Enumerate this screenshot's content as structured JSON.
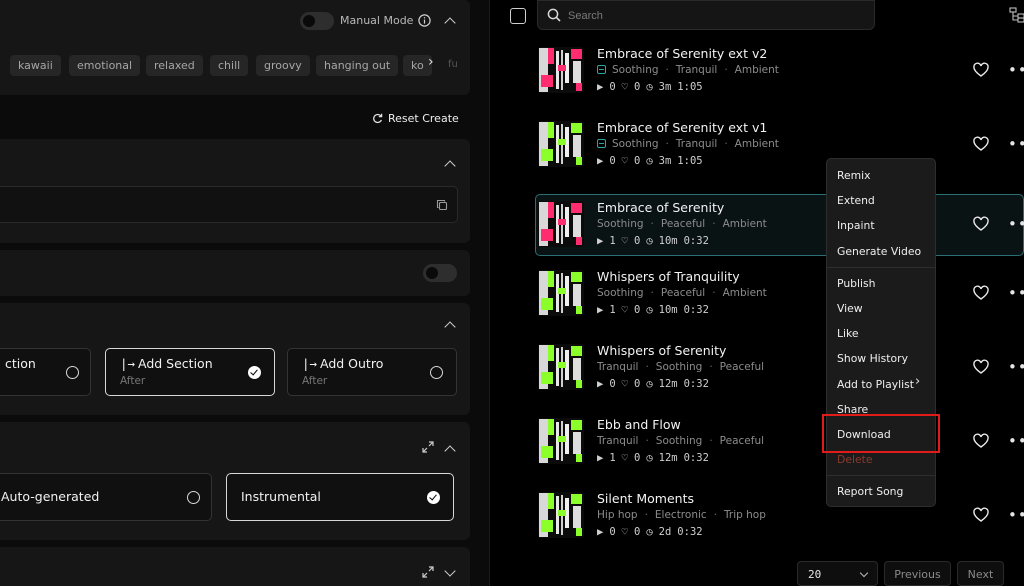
{
  "left": {
    "manual_mode": {
      "label": "Manual Mode"
    },
    "tags": [
      "kawaii",
      "emotional",
      "relaxed",
      "chill",
      "groovy",
      "hanging out",
      "ko"
    ],
    "tag_overflow": "fu",
    "reset_create": "Reset Create",
    "sections": {
      "cards": [
        {
          "title": "ction",
          "sub": ""
        },
        {
          "title": "Add Section",
          "sub": "After"
        },
        {
          "title": "Add Outro",
          "sub": "After"
        }
      ]
    },
    "lyrics": {
      "cards": [
        {
          "title": "Auto-generated"
        },
        {
          "title": "Instrumental"
        }
      ]
    }
  },
  "right": {
    "search": {
      "placeholder": "Search"
    },
    "songs": [
      {
        "title": "Embrace of Serenity ext v2",
        "tags": [
          "Soothing",
          "Tranquil",
          "Ambient"
        ],
        "plays": "0",
        "likes": "0",
        "age": "3m",
        "duration": "1:05"
      },
      {
        "title": "Embrace of Serenity ext v1",
        "tags": [
          "Soothing",
          "Tranquil",
          "Ambient"
        ],
        "plays": "0",
        "likes": "0",
        "age": "3m",
        "duration": "1:05"
      },
      {
        "title": "Embrace of Serenity",
        "tags": [
          "Soothing",
          "Peaceful",
          "Ambient"
        ],
        "plays": "1",
        "likes": "0",
        "age": "10m",
        "duration": "0:32"
      },
      {
        "title": "Whispers of Tranquility",
        "tags": [
          "Soothing",
          "Peaceful",
          "Ambient"
        ],
        "plays": "1",
        "likes": "0",
        "age": "10m",
        "duration": "0:32"
      },
      {
        "title": "Whispers of Serenity",
        "tags": [
          "Tranquil",
          "Soothing",
          "Peaceful"
        ],
        "plays": "0",
        "likes": "0",
        "age": "12m",
        "duration": "0:32"
      },
      {
        "title": "Ebb and Flow",
        "tags": [
          "Tranquil",
          "Soothing",
          "Peaceful"
        ],
        "plays": "1",
        "likes": "0",
        "age": "12m",
        "duration": "0:32"
      },
      {
        "title": "Silent Moments",
        "tags": [
          "Hip hop",
          "Electronic",
          "Trip hop"
        ],
        "plays": "0",
        "likes": "0",
        "age": "2d",
        "duration": "0:32"
      }
    ],
    "context_menu": {
      "items": [
        "Remix",
        "Extend",
        "Inpaint",
        "Generate Video",
        "Publish",
        "View",
        "Like",
        "Show History",
        "Add to Playlist",
        "Share",
        "Download",
        "Delete",
        "Report Song"
      ]
    },
    "pagination": {
      "per_page": "20",
      "previous": "Previous",
      "next": "Next"
    }
  },
  "colors": {
    "accent_teal": "#2fa3a0",
    "highlight_red": "#e11a1a",
    "thumb_pink": "#ff2d6f",
    "thumb_green": "#8bff2a"
  }
}
